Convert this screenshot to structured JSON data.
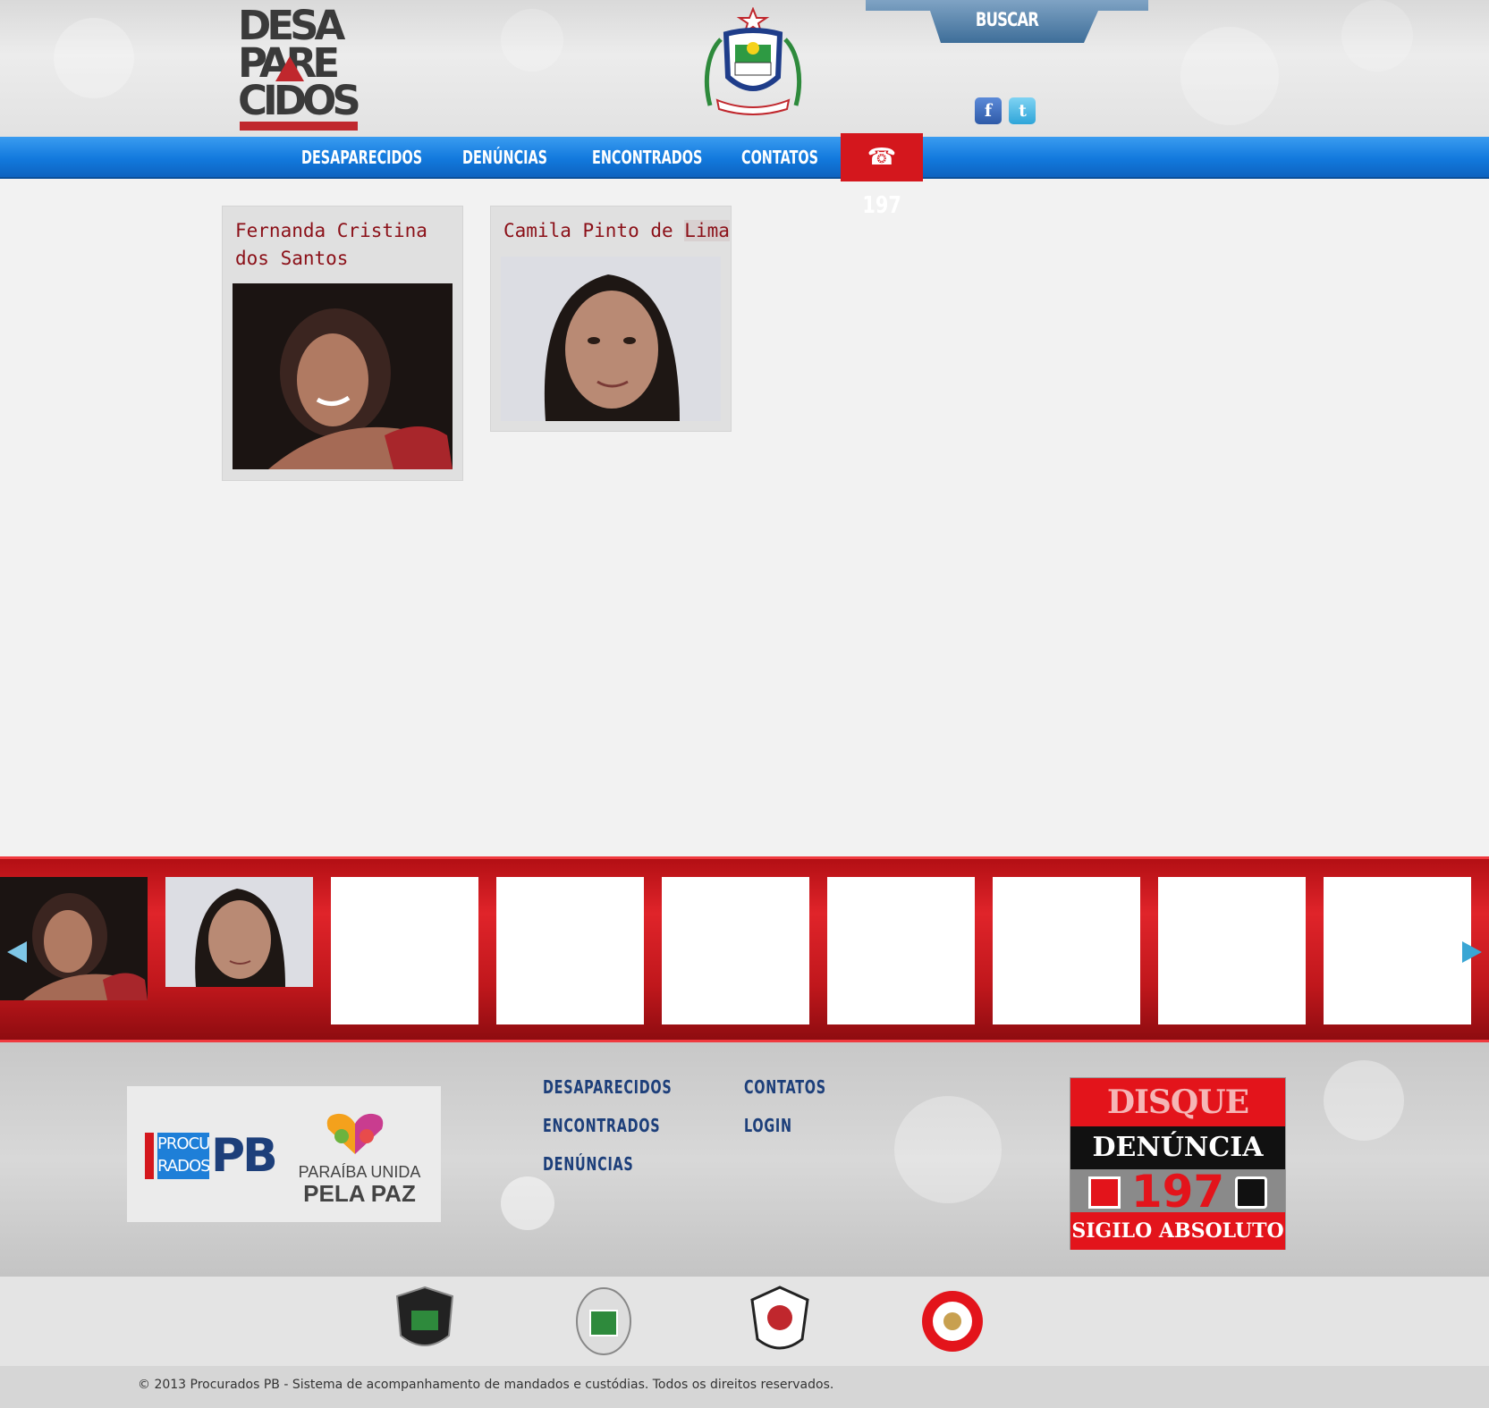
{
  "header": {
    "logo_lines": [
      "DESA",
      "PARE",
      "CIDOS"
    ],
    "search_label": "BUSCAR",
    "social": {
      "facebook": "f",
      "twitter": "t"
    }
  },
  "nav": {
    "items": [
      "DESAPARECIDOS",
      "DENÚNCIAS",
      "ENCONTRADOS",
      "CONTATOS"
    ],
    "phone_icon": "☎",
    "phone_number": "197"
  },
  "cards": [
    {
      "name": "Fernanda Cristina dos Santos",
      "photo": "person-photo-fernanda"
    },
    {
      "name_plain": "Camila Pinto de ",
      "name_highlight": "Lima",
      "photo": "person-photo-camila"
    }
  ],
  "carousel": {
    "prev_icon": "arrow-left-icon",
    "next_icon": "arrow-right-icon",
    "slots": 9
  },
  "footer": {
    "partners": {
      "procurados_line1": "PROCU",
      "procurados_line2": "RADOS",
      "procurados_pb": "PB",
      "paz_line1": "PARAÍBA UNIDA",
      "paz_line2": "PELA PAZ"
    },
    "links_col1": [
      "DESAPARECIDOS",
      "ENCONTRADOS",
      "DENÚNCIAS"
    ],
    "links_col2": [
      "CONTATOS",
      "LOGIN"
    ],
    "disque": {
      "line1": "DISQUE",
      "line2": "DENÚNCIA",
      "number": "197",
      "line4": "SIGILO ABSOLUTO"
    }
  },
  "badges": [
    "policia-civil-badge",
    "policia-militar-badge",
    "instituto-policia-cientifica-badge",
    "corpo-bombeiros-badge"
  ],
  "copyright": "© 2013 Procurados PB - Sistema de acompanhamento de mandados e custódias. Todos os direitos reservados.",
  "colors": {
    "nav_blue": "#1279dd",
    "brand_red": "#d4171d",
    "name_red": "#8b1018",
    "footer_link": "#1d3f7a"
  }
}
